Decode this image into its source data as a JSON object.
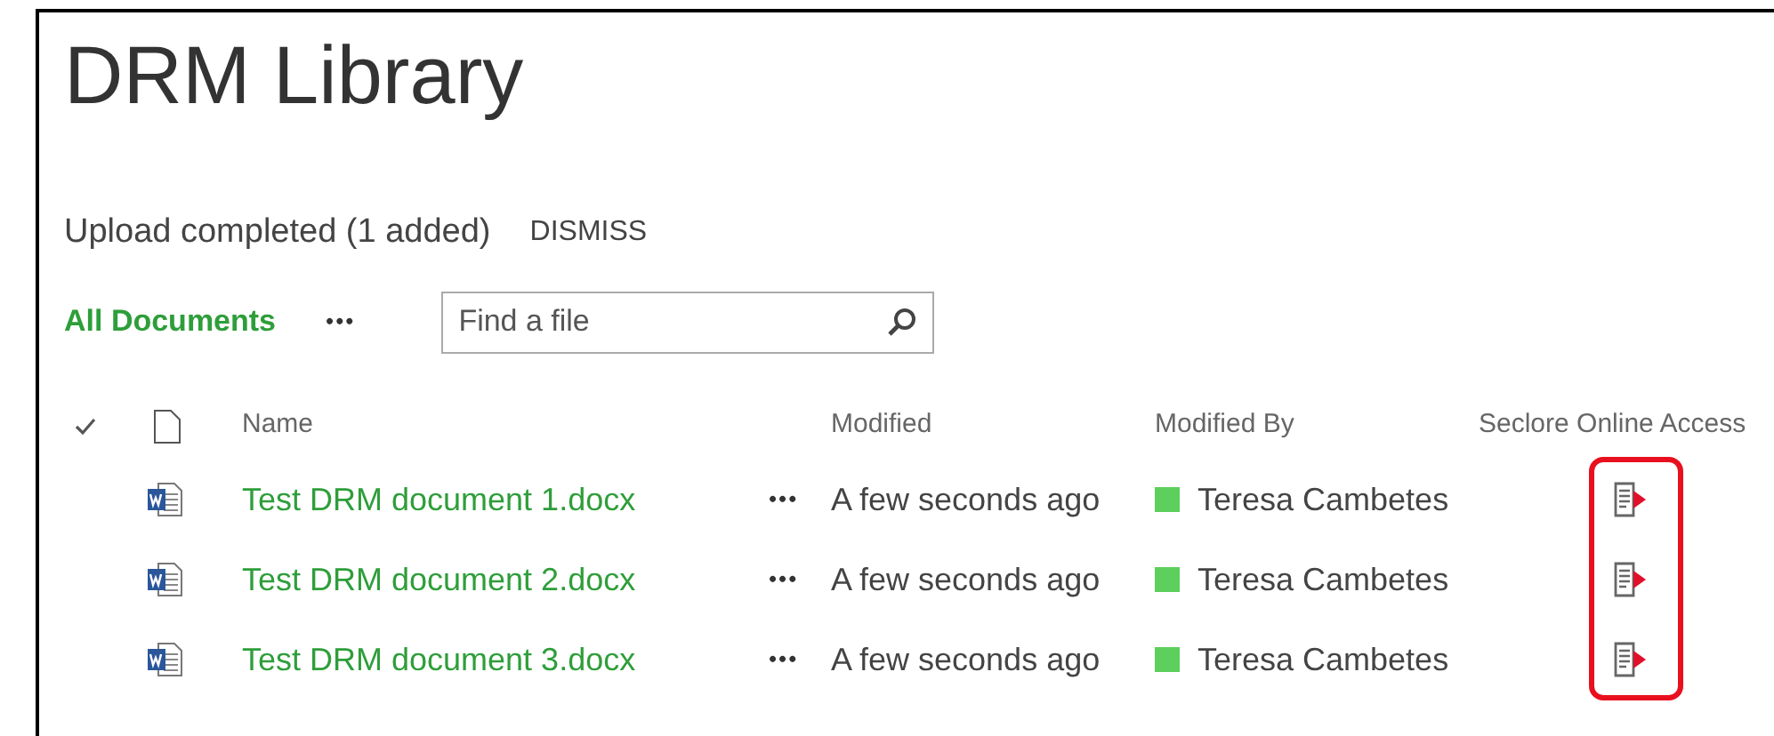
{
  "title": "DRM Library",
  "notification": {
    "message": "Upload completed (1 added)",
    "action": "DISMISS"
  },
  "view": {
    "label": "All Documents",
    "more": "•••"
  },
  "search": {
    "placeholder": "Find a file"
  },
  "columns": [
    "Name",
    "Modified",
    "Modified By",
    "Seclore Online Access"
  ],
  "rows": [
    {
      "name": "Test DRM document 1.docx",
      "menu": "•••",
      "modified": "A few seconds ago",
      "modified_by": "Teresa Cambetes"
    },
    {
      "name": "Test DRM document 2.docx",
      "menu": "•••",
      "modified": "A few seconds ago",
      "modified_by": "Teresa Cambetes"
    },
    {
      "name": "Test DRM document 3.docx",
      "menu": "•••",
      "modified": "A few seconds ago",
      "modified_by": "Teresa Cambetes"
    }
  ]
}
